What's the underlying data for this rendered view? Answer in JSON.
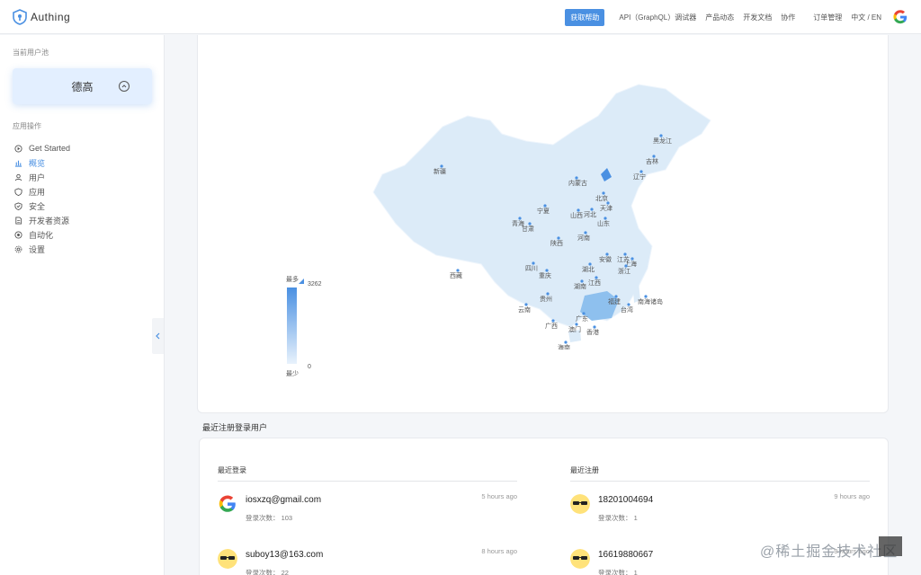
{
  "header": {
    "logo_text": "Authing",
    "nav": {
      "help": "获取帮助",
      "api": "API（GraphQL）调试器",
      "news": "产品动态",
      "docs": "开发文档",
      "coop": "协作",
      "orders": "订单管理",
      "lang": "中文 / EN"
    }
  },
  "sidebar": {
    "pool_label": "当前用户池",
    "pool_name": "德高",
    "ops_label": "应用操作",
    "items": [
      {
        "label": "Get Started",
        "icon": "play-circle-icon"
      },
      {
        "label": "概览",
        "icon": "bar-chart-icon"
      },
      {
        "label": "用户",
        "icon": "user-icon"
      },
      {
        "label": "应用",
        "icon": "shield-icon"
      },
      {
        "label": "安全",
        "icon": "shield-check-icon"
      },
      {
        "label": "开发者资源",
        "icon": "file-icon"
      },
      {
        "label": "自动化",
        "icon": "target-icon"
      },
      {
        "label": "设置",
        "icon": "gear-icon"
      }
    ]
  },
  "map": {
    "legend": {
      "high": "最多",
      "low": "最少",
      "max": "3262",
      "min": "0"
    },
    "provinces": [
      "黑龙江",
      "吉林",
      "辽宁",
      "新疆",
      "内蒙古",
      "北京",
      "天津",
      "河北",
      "山西",
      "宁夏",
      "青海",
      "甘肃",
      "山东",
      "陕西",
      "河南",
      "西藏",
      "四川",
      "重庆",
      "湖北",
      "安徽",
      "江苏",
      "上海",
      "浙江",
      "湖南",
      "江西",
      "贵州",
      "云南",
      "福建",
      "南海诸岛",
      "台湾",
      "广西",
      "广东",
      "澳门",
      "香港",
      "海南"
    ]
  },
  "recent": {
    "title": "最近注册登录用户",
    "login_title": "最近登录",
    "register_title": "最近注册",
    "login_users": [
      {
        "name": "iosxzq@gmail.com",
        "count": "登录次数： 103",
        "time": "5 hours ago"
      },
      {
        "name": "suboy13@163.com",
        "count": "登录次数： 22",
        "time": "8 hours ago"
      }
    ],
    "register_users": [
      {
        "name": "18201004694",
        "count": "登录次数： 1",
        "time": "9 hours ago"
      },
      {
        "name": "16619880667",
        "count": "登录次数： 1",
        "time": "9 hours ago"
      }
    ]
  },
  "watermark": "@稀土掘金技术社区",
  "colors": {
    "accent": "#4a90e2",
    "map_fill": "#dcebf8"
  }
}
